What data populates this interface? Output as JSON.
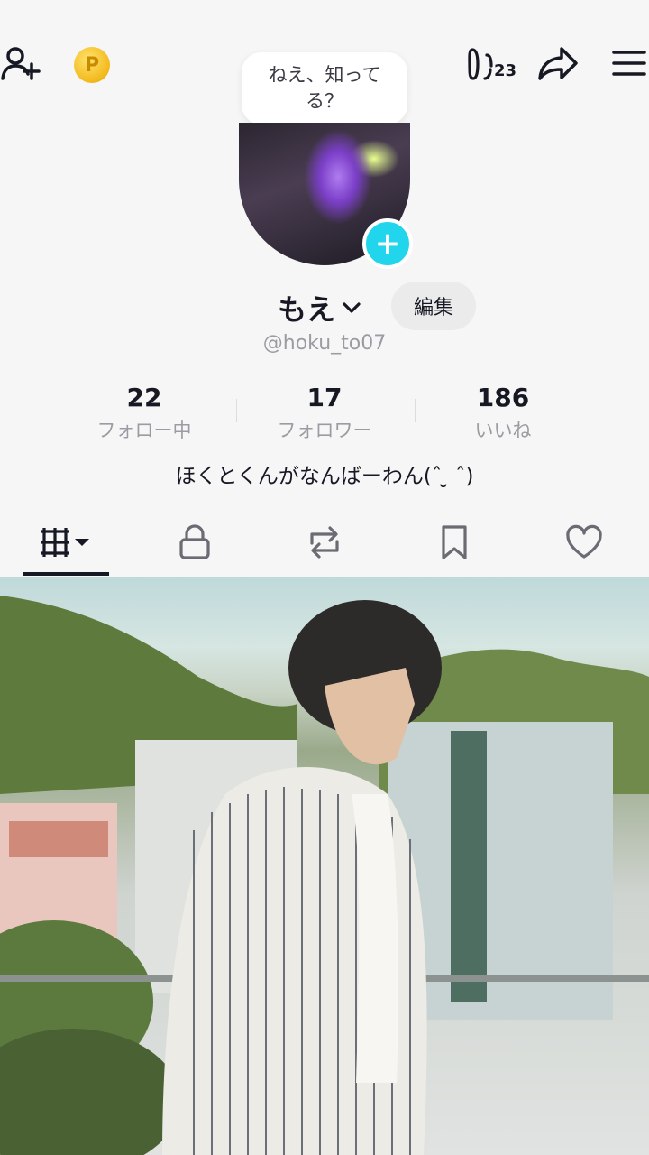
{
  "bubble_text": "ねえ、知ってる？",
  "counter_badge": "23",
  "profile": {
    "name": "もえ",
    "edit_label": "編集",
    "handle": "@hoku_to07",
    "bio": "ほくとくんがなんばーわん(ˆ ̮̮ ˆ)"
  },
  "stats": [
    {
      "value": "22",
      "label": "フォロー中"
    },
    {
      "value": "17",
      "label": "フォロワー"
    },
    {
      "value": "186",
      "label": "いいね"
    }
  ],
  "tabs": [
    "videos-icon",
    "lock-icon",
    "repost-icon",
    "bookmark-icon",
    "heart-icon"
  ],
  "colors": {
    "accent": "#20d5ec",
    "coin": "#f3b81c"
  }
}
